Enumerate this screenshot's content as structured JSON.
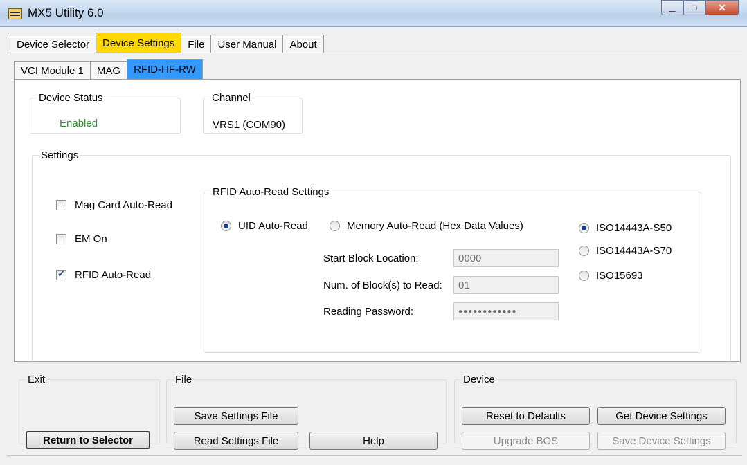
{
  "window": {
    "title": "MX5 Utility 6.0",
    "controls": {
      "minimize": "▁",
      "maximize": "□",
      "close": "✕"
    }
  },
  "main_tabs": [
    "Device Selector",
    "Device Settings",
    "File",
    "User Manual",
    "About"
  ],
  "sub_tabs": [
    "VCI Module 1",
    "MAG",
    "RFID-HF-RW"
  ],
  "device_status": {
    "legend": "Device Status",
    "value": "Enabled",
    "color": "#2e8b2e"
  },
  "channel": {
    "legend": "Channel",
    "value": "VRS1 (COM90)"
  },
  "settings": {
    "legend": "Settings",
    "checkboxes": [
      {
        "label": "Mag Card Auto-Read",
        "checked": false
      },
      {
        "label": "EM On",
        "checked": false
      },
      {
        "label": "RFID Auto-Read",
        "checked": true
      }
    ],
    "rfid": {
      "legend": "RFID Auto-Read Settings",
      "mode_uid": "UID Auto-Read",
      "mode_memory": "Memory Auto-Read (Hex Data Values)",
      "start_block_label": "Start Block Location:",
      "start_block_value": "0000",
      "num_blocks_label": "Num. of Block(s) to Read:",
      "num_blocks_value": "01",
      "password_label": "Reading Password:",
      "password_value": "●●●●●●●●●●●●",
      "protocols": [
        "ISO14443A-S50",
        "ISO14443A-S70",
        "ISO15693"
      ],
      "selected_protocol": "ISO14443A-S50"
    }
  },
  "exit_group": {
    "legend": "Exit",
    "return_button": "Return to Selector"
  },
  "file_group": {
    "legend": "File",
    "save_button": "Save Settings File",
    "read_button": "Read Settings File",
    "help_button": "Help"
  },
  "device_group": {
    "legend": "Device",
    "reset_button": "Reset to Defaults",
    "get_button": "Get Device Settings",
    "upgrade_button": "Upgrade BOS",
    "save_button": "Save Device Settings"
  }
}
